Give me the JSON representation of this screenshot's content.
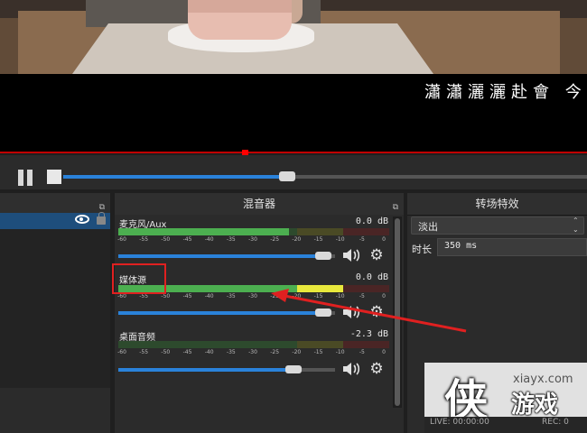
{
  "preview": {
    "subtitle": "瀟瀟灑灑赴會 今"
  },
  "panels": {
    "mixer_title": "混音器",
    "transition_title": "转场特效",
    "dock_glyph": "⧉"
  },
  "mixer": {
    "channels": [
      {
        "name": "麦克风/Aux",
        "db": "0.0 dB",
        "level": 0.63,
        "volume": 0.96
      },
      {
        "name": "媒体源",
        "db": "0.0 dB",
        "level": 0.83,
        "volume": 0.96
      },
      {
        "name": "桌面音频",
        "db": "-2.3 dB",
        "level": 0.0,
        "volume": 0.82
      }
    ],
    "scale": [
      "-60",
      "-55",
      "-50",
      "-45",
      "-40",
      "-35",
      "-30",
      "-25",
      "-20",
      "-15",
      "-10",
      "-5",
      "0"
    ]
  },
  "transition": {
    "selected": "淡出",
    "duration_label": "时长",
    "duration_value": "350 ms"
  },
  "watermark": {
    "site": "xiayx.com",
    "char": "侠",
    "name": "游戏"
  },
  "status": {
    "live": "LIVE: 00:00:00",
    "rec": "REC: 0"
  },
  "colors": {
    "accent": "#2a82da",
    "meter_green": "#4caf50",
    "meter_yellow": "#e8e83c",
    "meter_red": "#d04040",
    "annotation": "#e02020"
  }
}
